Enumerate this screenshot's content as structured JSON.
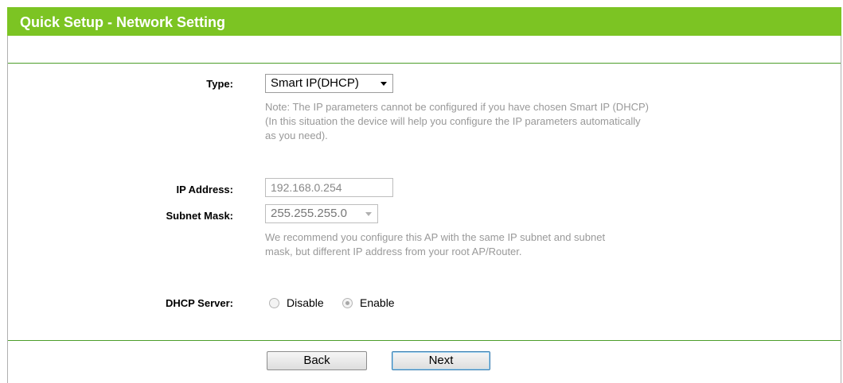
{
  "header": {
    "title": "Quick Setup - Network Setting"
  },
  "type_field": {
    "label": "Type:",
    "value": "Smart IP(DHCP)",
    "note": [
      "Note: The IP parameters cannot be configured if you have chosen Smart IP (DHCP)",
      "(In this situation the device will help you configure the IP parameters automatically",
      "as you need)."
    ]
  },
  "ip_field": {
    "label": "IP Address:",
    "value": "192.168.0.254"
  },
  "subnet_field": {
    "label": "Subnet Mask:",
    "value": "255.255.255.0",
    "note": [
      "We recommend you configure this AP with the same IP subnet and subnet",
      "mask, but different IP address from your root AP/Router."
    ]
  },
  "dhcp_field": {
    "label": "DHCP Server:",
    "options": [
      {
        "label": "Disable",
        "selected": false
      },
      {
        "label": "Enable",
        "selected": true
      }
    ]
  },
  "buttons": {
    "back": "Back",
    "next": "Next"
  },
  "colors": {
    "titlebar": "#7cc423",
    "divider": "#4d9e2b",
    "note_text": "#999999"
  }
}
